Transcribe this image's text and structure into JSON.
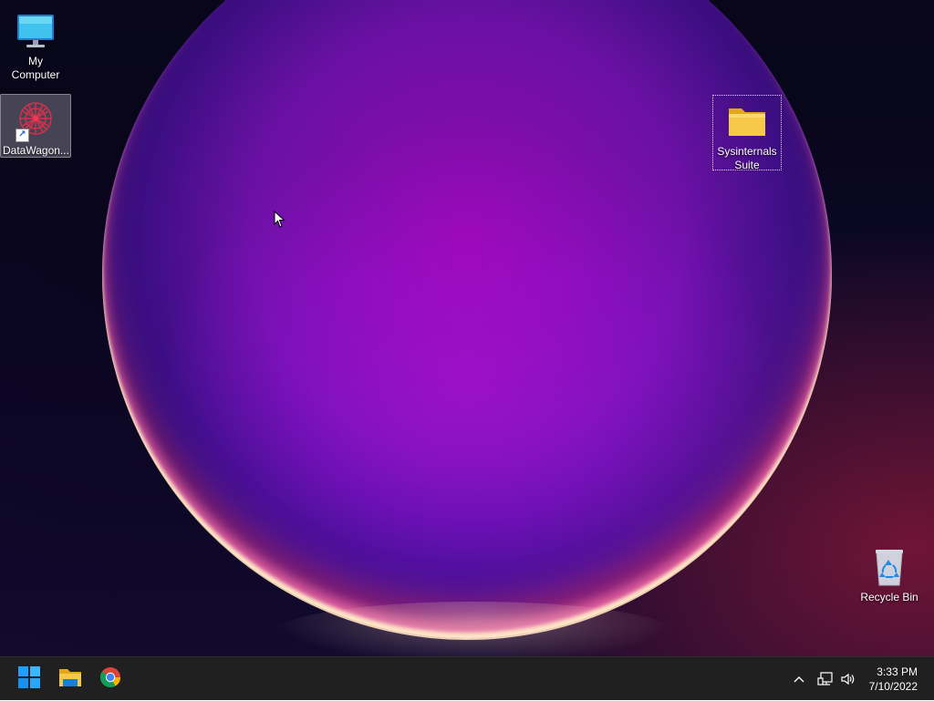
{
  "desktop": {
    "icons": {
      "my_computer": {
        "label": "My Computer",
        "icon": "monitor-icon"
      },
      "datawagon": {
        "label": "DataWagon...",
        "icon": "datawagon-shortcut-icon"
      },
      "sysinternals": {
        "label": "Sysinternals Suite",
        "icon": "folder-icon"
      },
      "recycle_bin": {
        "label": "Recycle Bin",
        "icon": "recycle-bin-icon"
      }
    }
  },
  "taskbar": {
    "start": {
      "icon": "windows-start-icon"
    },
    "pinned": [
      {
        "name": "File Explorer",
        "icon": "file-explorer-icon"
      },
      {
        "name": "Google Chrome",
        "icon": "chrome-icon"
      }
    ],
    "tray": {
      "chevron": "chevron-up-icon",
      "network": "network-icon",
      "volume": "volume-icon"
    },
    "clock": {
      "time": "3:33 PM",
      "date": "7/10/2022"
    }
  },
  "colors": {
    "taskbar_bg": "#202020",
    "folder_yellow": "#f7c948",
    "windows_blue": "#1ea0ff"
  }
}
